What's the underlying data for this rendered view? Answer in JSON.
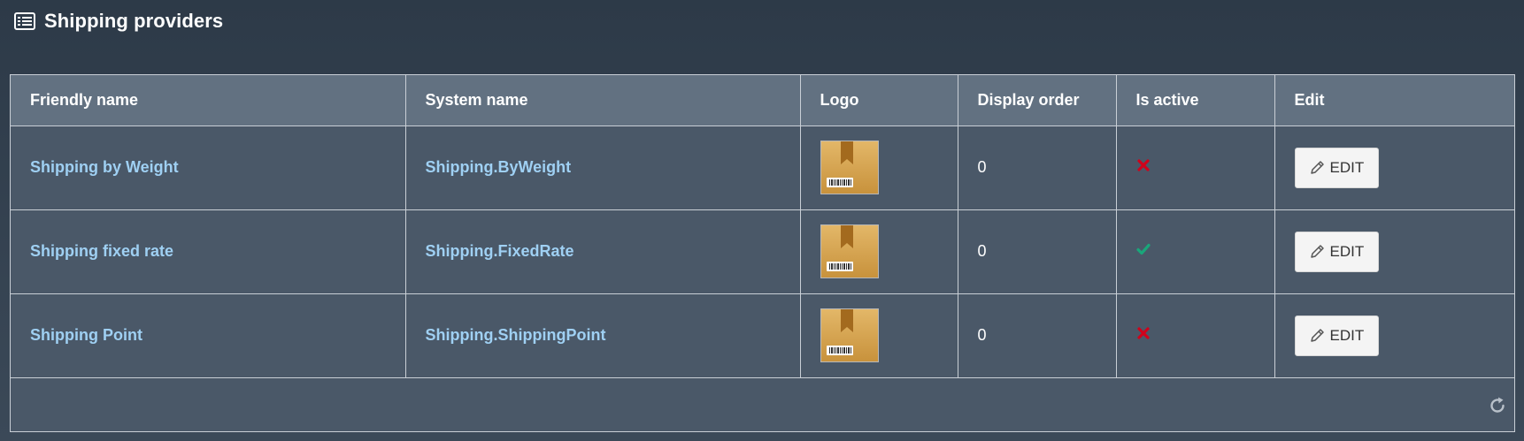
{
  "header": {
    "title": "Shipping providers",
    "icon": "list-icon"
  },
  "grid": {
    "columns": [
      "Friendly name",
      "System name",
      "Logo",
      "Display order",
      "Is active",
      "Edit"
    ],
    "rows": [
      {
        "friendly_name": "Shipping by Weight",
        "system_name": "Shipping.ByWeight",
        "logo": "package-icon",
        "display_order": "0",
        "is_active": false,
        "edit_label": "EDIT"
      },
      {
        "friendly_name": "Shipping fixed rate",
        "system_name": "Shipping.FixedRate",
        "logo": "package-icon",
        "display_order": "0",
        "is_active": true,
        "edit_label": "EDIT"
      },
      {
        "friendly_name": "Shipping Point",
        "system_name": "Shipping.ShippingPoint",
        "logo": "package-icon",
        "display_order": "0",
        "is_active": false,
        "edit_label": "EDIT"
      }
    ],
    "footer": {
      "refresh_icon": "refresh-icon"
    }
  },
  "colors": {
    "link": "#9fd0f3",
    "active": "#1aa67a",
    "inactive": "#d0021b",
    "header_bg": "#627181",
    "row_bg": "#4a5868"
  }
}
